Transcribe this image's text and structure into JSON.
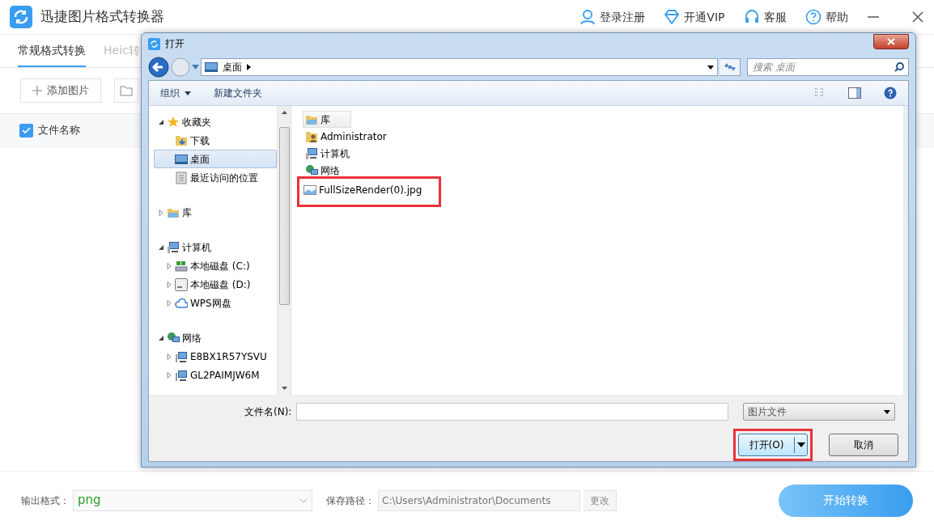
{
  "app": {
    "title": "迅捷图片格式转换器",
    "header_links": [
      {
        "label": "登录注册",
        "kind": "user"
      },
      {
        "label": "开通VIP",
        "kind": "vip"
      },
      {
        "label": "客服",
        "kind": "support"
      },
      {
        "label": "帮助",
        "kind": "help"
      }
    ]
  },
  "tabs": [
    {
      "label": "常规格式转换",
      "selected": true
    },
    {
      "label": "Heic转",
      "selected": false
    }
  ],
  "toolbar": {
    "add_button": "添加图片"
  },
  "file_table": {
    "select_all_checked": true,
    "column": "文件名称"
  },
  "dialog": {
    "title": "打开",
    "breadcrumb": "桌面",
    "search": {
      "placeholder": "搜索 桌面"
    },
    "organize": "组织",
    "new_folder": "新建文件夹",
    "nav_tree": [
      {
        "label": "收藏夹",
        "kind": "star",
        "expanded": true,
        "selected": false,
        "children": [
          {
            "label": "下载",
            "kind": "download",
            "selected": false
          },
          {
            "label": "桌面",
            "kind": "desktop",
            "selected": true
          },
          {
            "label": "最近访问的位置",
            "kind": "recent",
            "selected": false
          }
        ]
      },
      {
        "label": "库",
        "kind": "library",
        "expanded": false,
        "selected": false
      },
      {
        "label": "计算机",
        "kind": "computer",
        "expanded": true,
        "selected": false,
        "children": [
          {
            "label": "本地磁盘 (C:)",
            "kind": "system-drive",
            "expanded": false,
            "selected": false
          },
          {
            "label": "本地磁盘 (D:)",
            "kind": "drive",
            "expanded": false,
            "selected": false
          },
          {
            "label": "WPS网盘",
            "kind": "cloud",
            "expanded": false,
            "selected": false
          }
        ]
      },
      {
        "label": "网络",
        "kind": "network",
        "expanded": true,
        "selected": false,
        "children": [
          {
            "label": "E8BX1R57YSVU",
            "kind": "pc",
            "expanded": false,
            "selected": false
          },
          {
            "label": "GL2PAIMJW6M",
            "kind": "pc",
            "expanded": false,
            "selected": false
          }
        ]
      }
    ],
    "files": [
      {
        "name": "库",
        "kind": "library",
        "selected": true,
        "highlighted": false
      },
      {
        "name": "Administrator",
        "kind": "user",
        "selected": false,
        "highlighted": false
      },
      {
        "name": "计算机",
        "kind": "computer",
        "selected": false,
        "highlighted": false
      },
      {
        "name": "网络",
        "kind": "network",
        "selected": false,
        "highlighted": false
      },
      {
        "name": "FullSizeRender(0).jpg",
        "kind": "image",
        "selected": false,
        "highlighted": true
      }
    ],
    "filename_label": "文件名(N):",
    "filetype": "图片文件",
    "open_button": {
      "label": "打开(O)",
      "highlighted": true
    },
    "cancel_button": "取消"
  },
  "bottom": {
    "format_label": "输出格式：",
    "format_value": "png",
    "path_label": "保存路径：",
    "path_value": "C:\\Users\\Administrator\\Documents",
    "change_button": "更改",
    "start_button": "开始转换"
  }
}
